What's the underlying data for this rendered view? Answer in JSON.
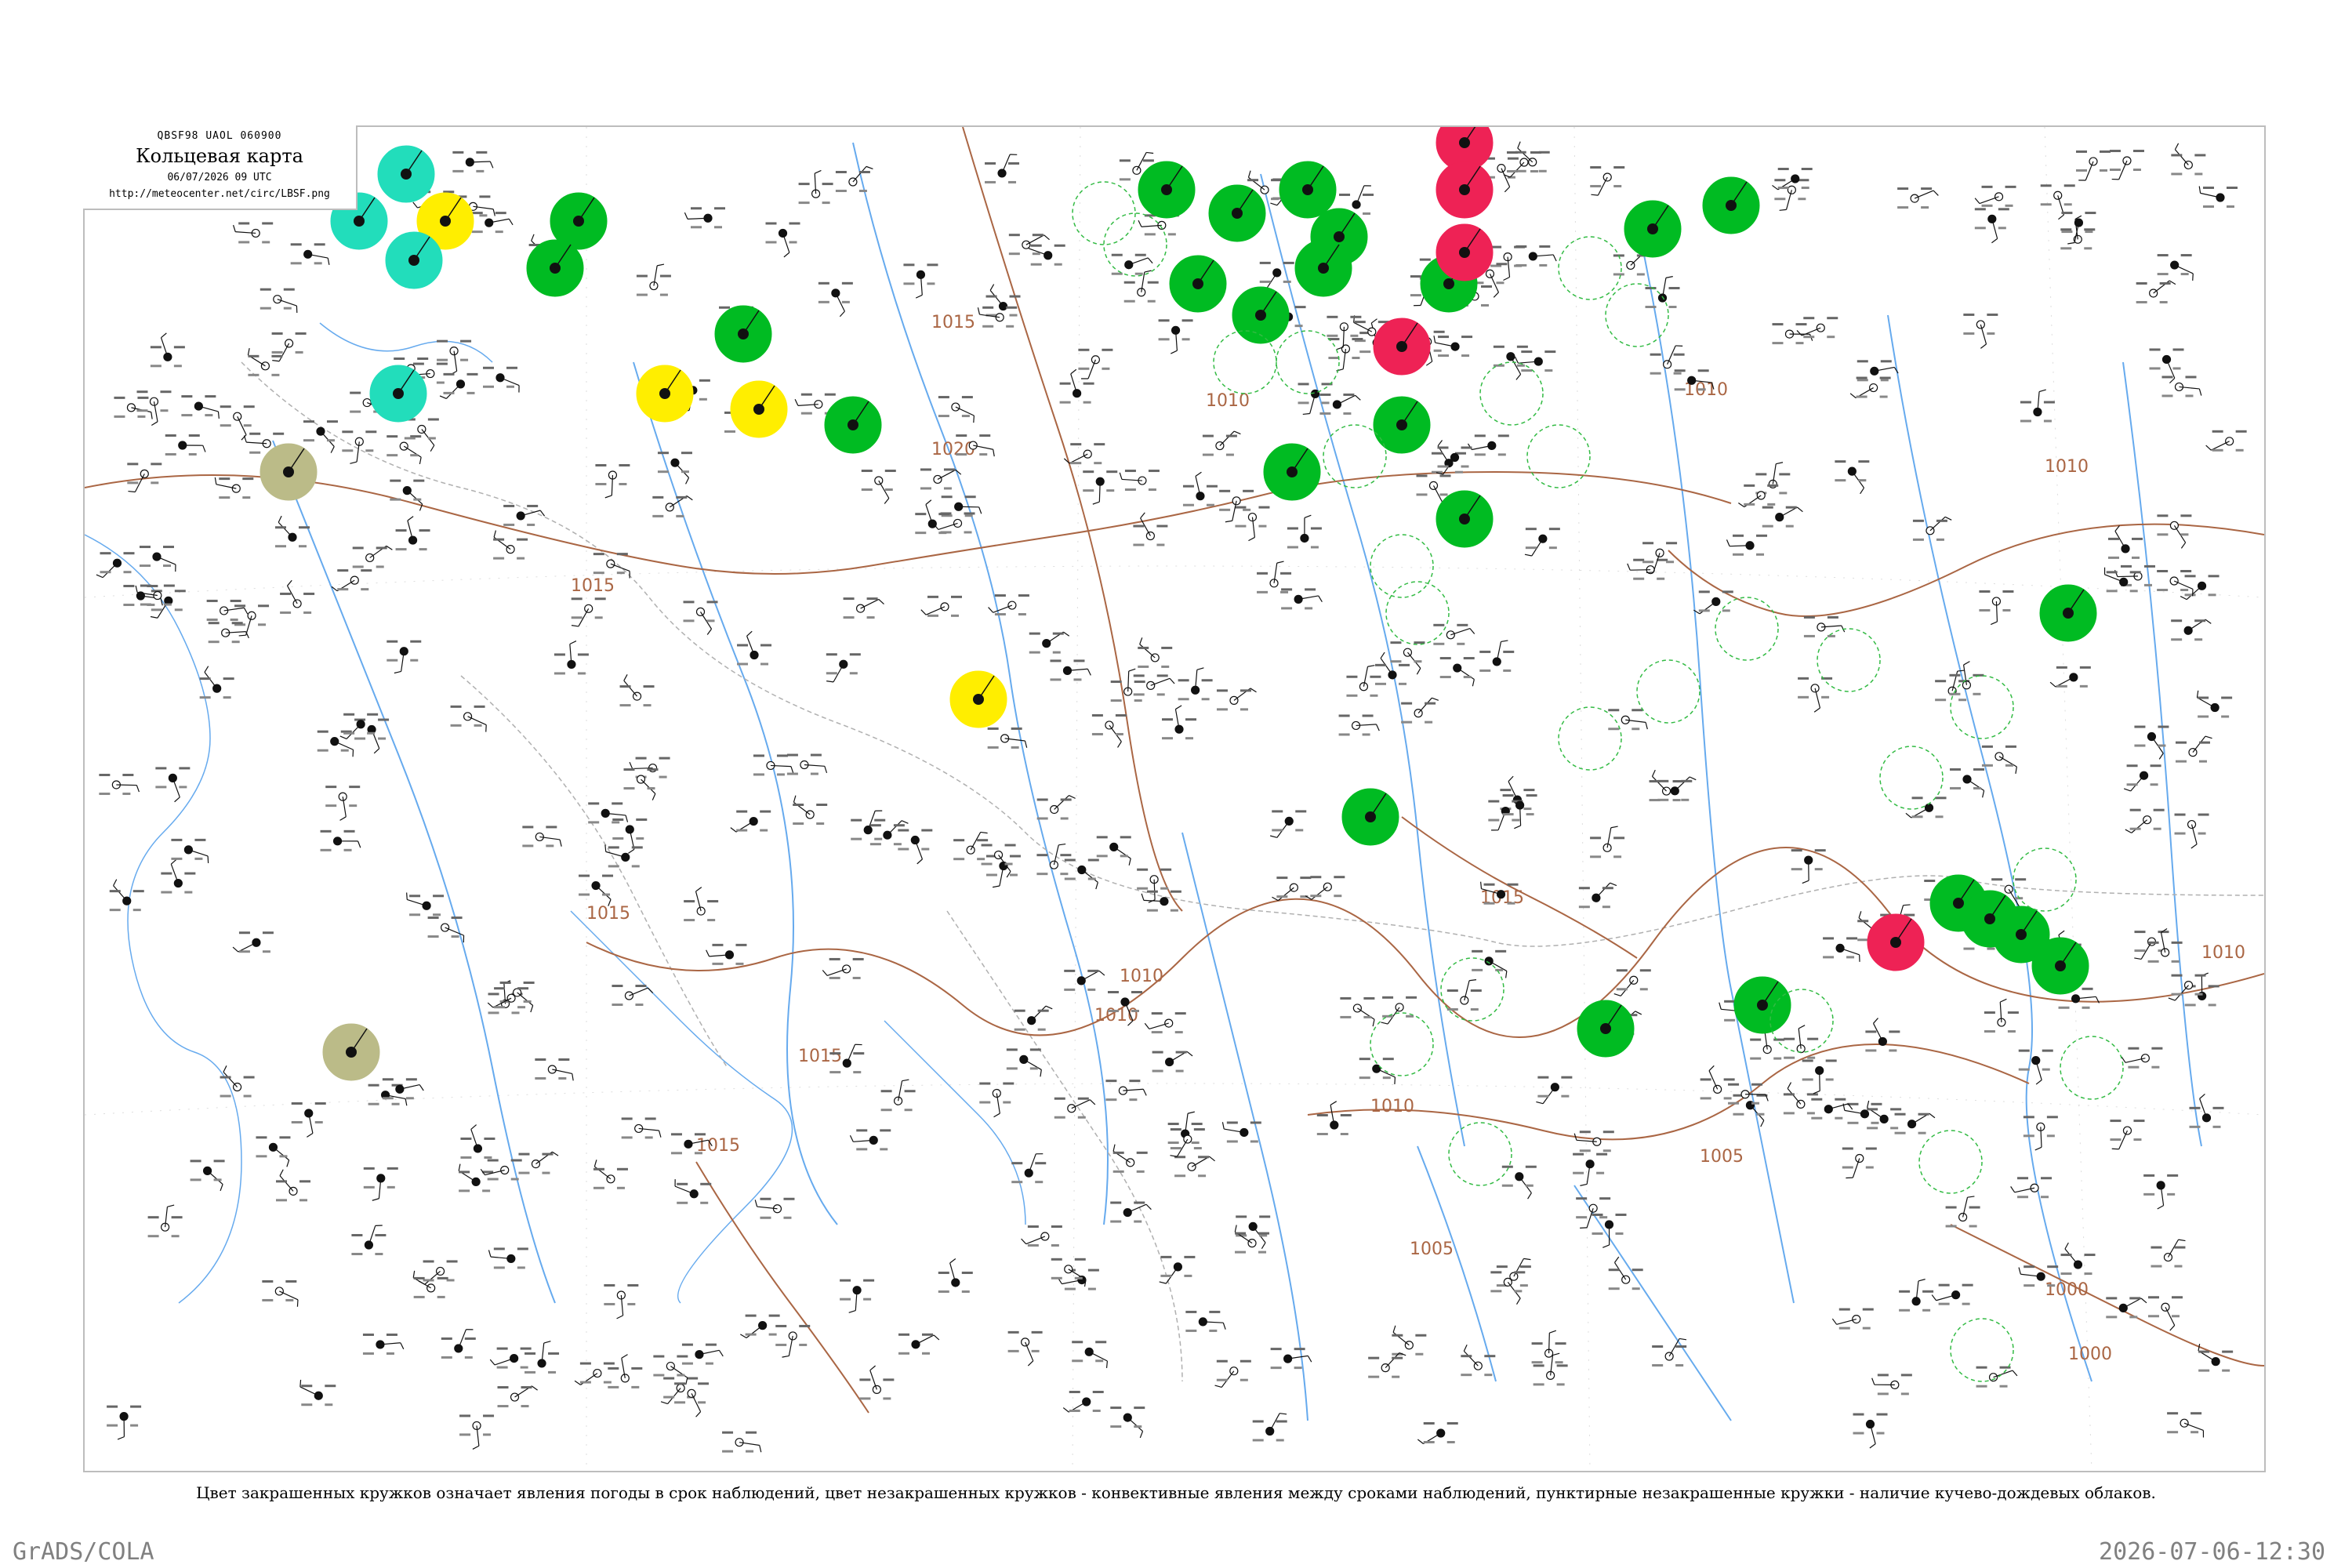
{
  "header": {
    "codes": "QBSF98  UAOL  060900",
    "title": "Кольцевая карта",
    "datetime": "06/07/2026 09 UTC",
    "url": "http://meteocenter.net/circ/LBSF.png"
  },
  "caption": "Цвет закрашенных кружков означает явления погоды в срок наблюдений, цвет незакрашенных кружков - конвективные явления между сроками наблюдений, пунктирные незакрашенные кружки - наличие кучево-дождевых облаков.",
  "footer": {
    "software": "GrADS/COLA",
    "timestamp": "2026-07-06-12:30"
  },
  "colors": {
    "rain": "#00bb22",
    "thunderstorm": "#ee2255",
    "shower": "#ffee00",
    "fog": "#22ddbb",
    "haze": "#bbbb88",
    "rivers": "#66aaee",
    "isobars": "#aa6644",
    "borders": "#999999"
  },
  "isobar_labels": [
    "1010",
    "1015",
    "1020",
    "1015",
    "1010",
    "1005",
    "1015",
    "1010",
    "1015",
    "1010",
    "1010",
    "1005",
    "1000",
    "1000",
    "1010",
    "1015",
    "1015",
    "1010"
  ],
  "weather_markers": [
    {
      "kind": "rain"
    },
    {
      "kind": "rain"
    },
    {
      "kind": "rain"
    },
    {
      "kind": "rain"
    },
    {
      "kind": "rain"
    },
    {
      "kind": "rain"
    },
    {
      "kind": "rain"
    },
    {
      "kind": "rain"
    },
    {
      "kind": "rain"
    },
    {
      "kind": "rain"
    },
    {
      "kind": "rain"
    },
    {
      "kind": "rain"
    },
    {
      "kind": "rain"
    },
    {
      "kind": "rain"
    },
    {
      "kind": "rain"
    },
    {
      "kind": "rain"
    },
    {
      "kind": "rain"
    },
    {
      "kind": "rain"
    },
    {
      "kind": "rain"
    },
    {
      "kind": "rain"
    },
    {
      "kind": "rain"
    },
    {
      "kind": "rain"
    },
    {
      "kind": "rain"
    },
    {
      "kind": "rain"
    },
    {
      "kind": "rain"
    },
    {
      "kind": "thunderstorm"
    },
    {
      "kind": "thunderstorm"
    },
    {
      "kind": "thunderstorm"
    },
    {
      "kind": "thunderstorm"
    },
    {
      "kind": "thunderstorm"
    },
    {
      "kind": "shower"
    },
    {
      "kind": "shower"
    },
    {
      "kind": "shower"
    },
    {
      "kind": "shower"
    },
    {
      "kind": "fog"
    },
    {
      "kind": "fog"
    },
    {
      "kind": "fog"
    },
    {
      "kind": "fog"
    },
    {
      "kind": "haze"
    },
    {
      "kind": "haze"
    }
  ]
}
